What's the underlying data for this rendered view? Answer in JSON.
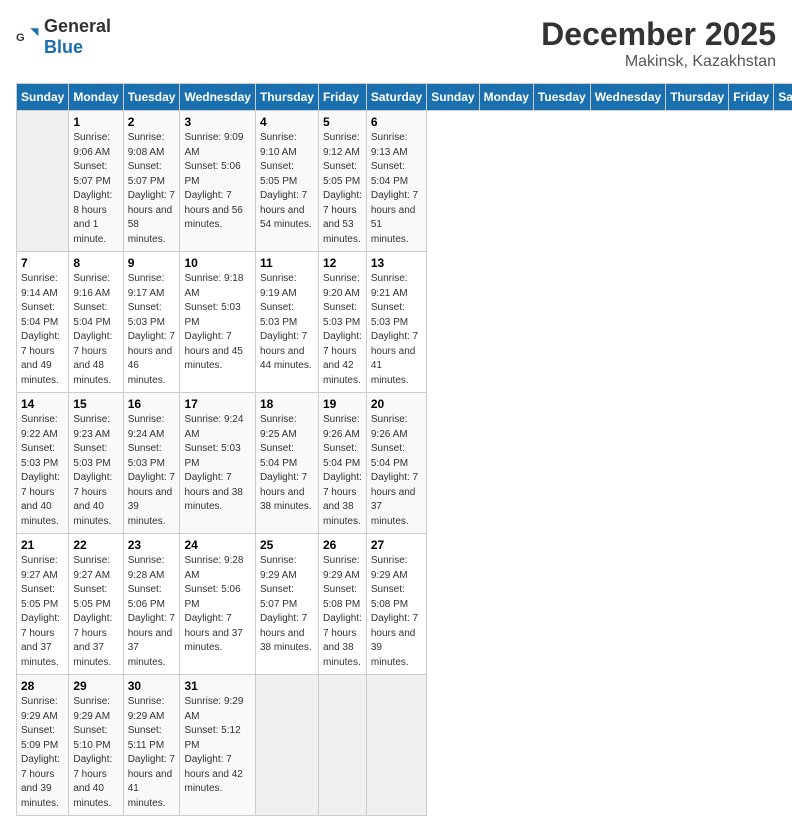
{
  "header": {
    "logo_general": "General",
    "logo_blue": "Blue",
    "month": "December 2025",
    "location": "Makinsk, Kazakhstan"
  },
  "days_of_week": [
    "Sunday",
    "Monday",
    "Tuesday",
    "Wednesday",
    "Thursday",
    "Friday",
    "Saturday"
  ],
  "weeks": [
    [
      {
        "day": "",
        "empty": true
      },
      {
        "day": "1",
        "sunrise": "9:06 AM",
        "sunset": "5:07 PM",
        "daylight": "8 hours and 1 minute."
      },
      {
        "day": "2",
        "sunrise": "9:08 AM",
        "sunset": "5:07 PM",
        "daylight": "7 hours and 58 minutes."
      },
      {
        "day": "3",
        "sunrise": "9:09 AM",
        "sunset": "5:06 PM",
        "daylight": "7 hours and 56 minutes."
      },
      {
        "day": "4",
        "sunrise": "9:10 AM",
        "sunset": "5:05 PM",
        "daylight": "7 hours and 54 minutes."
      },
      {
        "day": "5",
        "sunrise": "9:12 AM",
        "sunset": "5:05 PM",
        "daylight": "7 hours and 53 minutes."
      },
      {
        "day": "6",
        "sunrise": "9:13 AM",
        "sunset": "5:04 PM",
        "daylight": "7 hours and 51 minutes."
      }
    ],
    [
      {
        "day": "7",
        "sunrise": "9:14 AM",
        "sunset": "5:04 PM",
        "daylight": "7 hours and 49 minutes."
      },
      {
        "day": "8",
        "sunrise": "9:16 AM",
        "sunset": "5:04 PM",
        "daylight": "7 hours and 48 minutes."
      },
      {
        "day": "9",
        "sunrise": "9:17 AM",
        "sunset": "5:03 PM",
        "daylight": "7 hours and 46 minutes."
      },
      {
        "day": "10",
        "sunrise": "9:18 AM",
        "sunset": "5:03 PM",
        "daylight": "7 hours and 45 minutes."
      },
      {
        "day": "11",
        "sunrise": "9:19 AM",
        "sunset": "5:03 PM",
        "daylight": "7 hours and 44 minutes."
      },
      {
        "day": "12",
        "sunrise": "9:20 AM",
        "sunset": "5:03 PM",
        "daylight": "7 hours and 42 minutes."
      },
      {
        "day": "13",
        "sunrise": "9:21 AM",
        "sunset": "5:03 PM",
        "daylight": "7 hours and 41 minutes."
      }
    ],
    [
      {
        "day": "14",
        "sunrise": "9:22 AM",
        "sunset": "5:03 PM",
        "daylight": "7 hours and 40 minutes."
      },
      {
        "day": "15",
        "sunrise": "9:23 AM",
        "sunset": "5:03 PM",
        "daylight": "7 hours and 40 minutes."
      },
      {
        "day": "16",
        "sunrise": "9:24 AM",
        "sunset": "5:03 PM",
        "daylight": "7 hours and 39 minutes."
      },
      {
        "day": "17",
        "sunrise": "9:24 AM",
        "sunset": "5:03 PM",
        "daylight": "7 hours and 38 minutes."
      },
      {
        "day": "18",
        "sunrise": "9:25 AM",
        "sunset": "5:04 PM",
        "daylight": "7 hours and 38 minutes."
      },
      {
        "day": "19",
        "sunrise": "9:26 AM",
        "sunset": "5:04 PM",
        "daylight": "7 hours and 38 minutes."
      },
      {
        "day": "20",
        "sunrise": "9:26 AM",
        "sunset": "5:04 PM",
        "daylight": "7 hours and 37 minutes."
      }
    ],
    [
      {
        "day": "21",
        "sunrise": "9:27 AM",
        "sunset": "5:05 PM",
        "daylight": "7 hours and 37 minutes."
      },
      {
        "day": "22",
        "sunrise": "9:27 AM",
        "sunset": "5:05 PM",
        "daylight": "7 hours and 37 minutes."
      },
      {
        "day": "23",
        "sunrise": "9:28 AM",
        "sunset": "5:06 PM",
        "daylight": "7 hours and 37 minutes."
      },
      {
        "day": "24",
        "sunrise": "9:28 AM",
        "sunset": "5:06 PM",
        "daylight": "7 hours and 37 minutes."
      },
      {
        "day": "25",
        "sunrise": "9:29 AM",
        "sunset": "5:07 PM",
        "daylight": "7 hours and 38 minutes."
      },
      {
        "day": "26",
        "sunrise": "9:29 AM",
        "sunset": "5:08 PM",
        "daylight": "7 hours and 38 minutes."
      },
      {
        "day": "27",
        "sunrise": "9:29 AM",
        "sunset": "5:08 PM",
        "daylight": "7 hours and 39 minutes."
      }
    ],
    [
      {
        "day": "28",
        "sunrise": "9:29 AM",
        "sunset": "5:09 PM",
        "daylight": "7 hours and 39 minutes."
      },
      {
        "day": "29",
        "sunrise": "9:29 AM",
        "sunset": "5:10 PM",
        "daylight": "7 hours and 40 minutes."
      },
      {
        "day": "30",
        "sunrise": "9:29 AM",
        "sunset": "5:11 PM",
        "daylight": "7 hours and 41 minutes."
      },
      {
        "day": "31",
        "sunrise": "9:29 AM",
        "sunset": "5:12 PM",
        "daylight": "7 hours and 42 minutes."
      },
      {
        "day": "",
        "empty": true
      },
      {
        "day": "",
        "empty": true
      },
      {
        "day": "",
        "empty": true
      }
    ]
  ]
}
